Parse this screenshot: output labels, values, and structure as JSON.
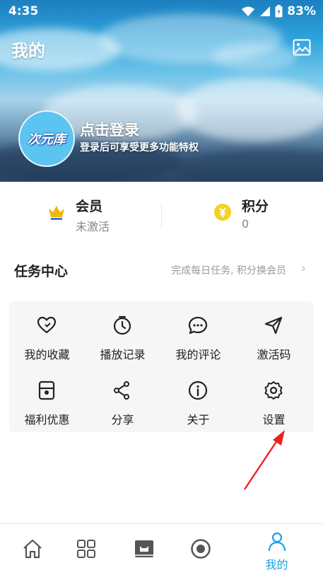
{
  "status_bar": {
    "time": "4:35",
    "battery": "83%"
  },
  "header": {
    "title": "我的",
    "avatar_text": "次元库",
    "login_title": "点击登录",
    "login_subtitle": "登录后可享受更多功能特权"
  },
  "stats": {
    "member": {
      "label": "会员",
      "value": "未激活",
      "icon": "crown-icon"
    },
    "points": {
      "label": "积分",
      "value": "0",
      "icon": "coin-icon"
    }
  },
  "task_center": {
    "title": "任务中心",
    "hint": "完成每日任务, 积分换会员"
  },
  "grid": [
    {
      "label": "我的收藏",
      "icon": "heart-icon"
    },
    {
      "label": "播放记录",
      "icon": "timer-icon"
    },
    {
      "label": "我的评论",
      "icon": "comment-icon"
    },
    {
      "label": "激活码",
      "icon": "send-icon"
    },
    {
      "label": "福利优惠",
      "icon": "coupon-icon"
    },
    {
      "label": "分享",
      "icon": "share-icon"
    },
    {
      "label": "关于",
      "icon": "info-icon"
    },
    {
      "label": "设置",
      "icon": "settings-icon"
    }
  ],
  "bottom_nav": [
    {
      "icon": "home-icon"
    },
    {
      "icon": "grid-icon"
    },
    {
      "icon": "library-icon"
    },
    {
      "icon": "record-icon"
    },
    {
      "icon": "profile-icon",
      "label": "我的",
      "active": true
    }
  ],
  "colors": {
    "accent": "#1aa2e8",
    "coin": "#f5d21c",
    "crown": "#f0b800",
    "arrow": "#e8231f"
  }
}
